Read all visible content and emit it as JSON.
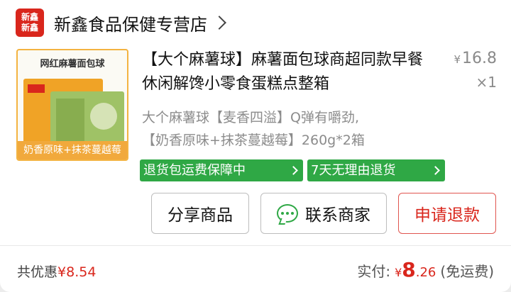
{
  "store": {
    "logo_text_line1": "新鑫",
    "logo_text_line2": "新鑫",
    "name": "新鑫食品保健专营店"
  },
  "product": {
    "thumbnail_title": "网红麻薯面包球",
    "thumbnail_caption": "奶香原味+抹茶蔓越莓",
    "title": "【大个麻薯球】麻薯面包球商超同款早餐休闲解馋小零食蛋糕点整箱",
    "price_symbol": "¥",
    "price": "16.8",
    "quantity": "×1",
    "spec_line1": "大个麻薯球【麦香四溢】Q弹有嚼劲,",
    "spec_line2": "【奶香原味+抹茶蔓越莓】260g*2箱",
    "tags": [
      "退货包运费保障中",
      "7天无理由退货"
    ]
  },
  "actions": {
    "share_label": "分享商品",
    "contact_label": "联系商家",
    "refund_label": "申请退款"
  },
  "totals": {
    "discount_label": "共优惠",
    "discount_amount": "¥8.54",
    "paid_label": "实付:",
    "paid_symbol": "¥",
    "paid_integer": "8",
    "paid_decimal": ".26",
    "paid_note": "(免运费)"
  },
  "colors": {
    "brand_red": "#d9261c",
    "tag_green": "#2fa845",
    "thumb_border": "#f3b341"
  }
}
